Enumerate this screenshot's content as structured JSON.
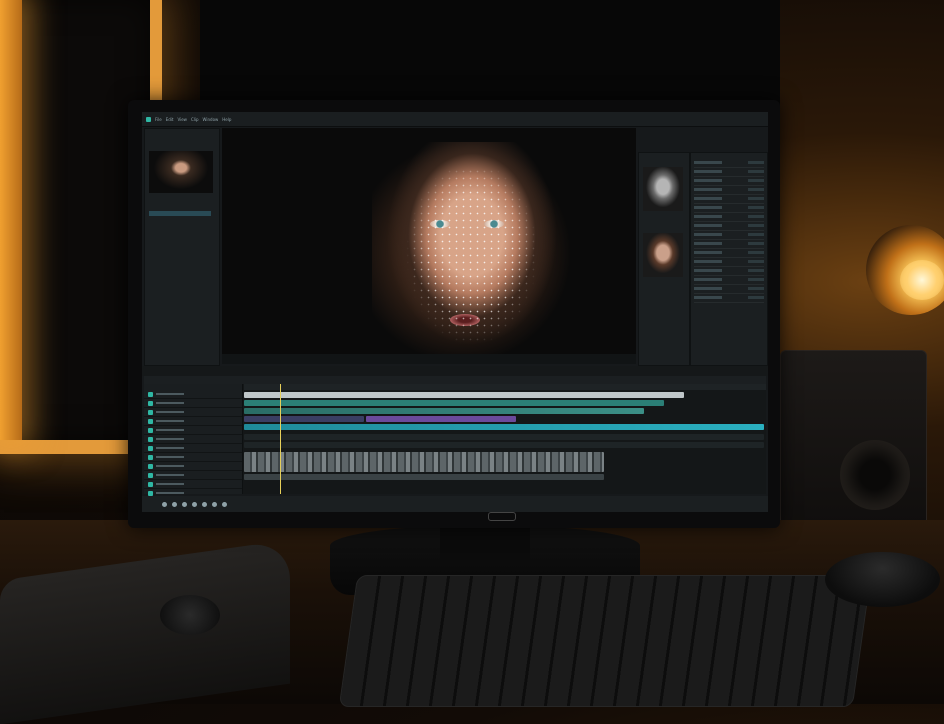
{
  "scene": {
    "description_tags": [
      "video-editing-workstation",
      "face-tracking"
    ]
  },
  "app": {
    "title": "",
    "menu": [
      "File",
      "Edit",
      "View",
      "Clip",
      "Window",
      "Help"
    ],
    "accent_color": "#2fb7a4",
    "playhead_color": "#e6cf5a"
  },
  "left_panel": {
    "title": "",
    "folders": [
      "",
      "",
      ""
    ]
  },
  "viewer": {
    "label": ""
  },
  "monitor": {
    "brand": ""
  },
  "timeline": {
    "tracks": 12
  }
}
